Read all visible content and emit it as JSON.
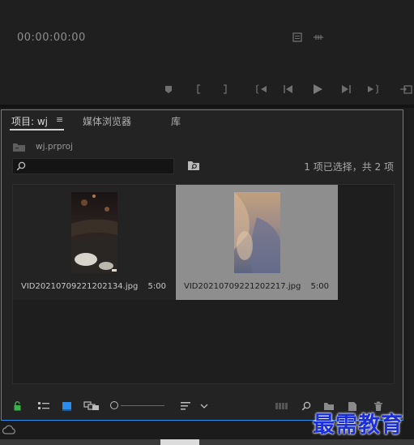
{
  "monitor": {
    "timecode": "00:00:00:00"
  },
  "project_panel": {
    "tabs": [
      {
        "label": "项目: wj"
      },
      {
        "label": "媒体浏览器"
      },
      {
        "label": "库"
      }
    ],
    "tab_menu_glyph": "≡",
    "project_file": "wj.prproj",
    "search": {
      "value": "",
      "placeholder": ""
    },
    "selection_status": "1 项已选择，共 2 项",
    "clips": [
      {
        "name": "VID20210709221202134.jpg",
        "duration": "5:00",
        "selected": false
      },
      {
        "name": "VID20210709221202217.jpg",
        "duration": "5:00",
        "selected": true
      }
    ],
    "accent_color": "#2d8ceb"
  },
  "toolbar": {
    "icons": [
      "lock-icon",
      "list-view-icon",
      "icon-view-icon",
      "freeform-view-icon",
      "zoom-slider",
      "sort-icon",
      "sort-dropdown-icon",
      "automate-sequence-icon",
      "find-icon",
      "new-bin-icon",
      "new-item-icon",
      "delete-icon"
    ],
    "zoom_level": 0.0
  },
  "watermark": "最需教育"
}
